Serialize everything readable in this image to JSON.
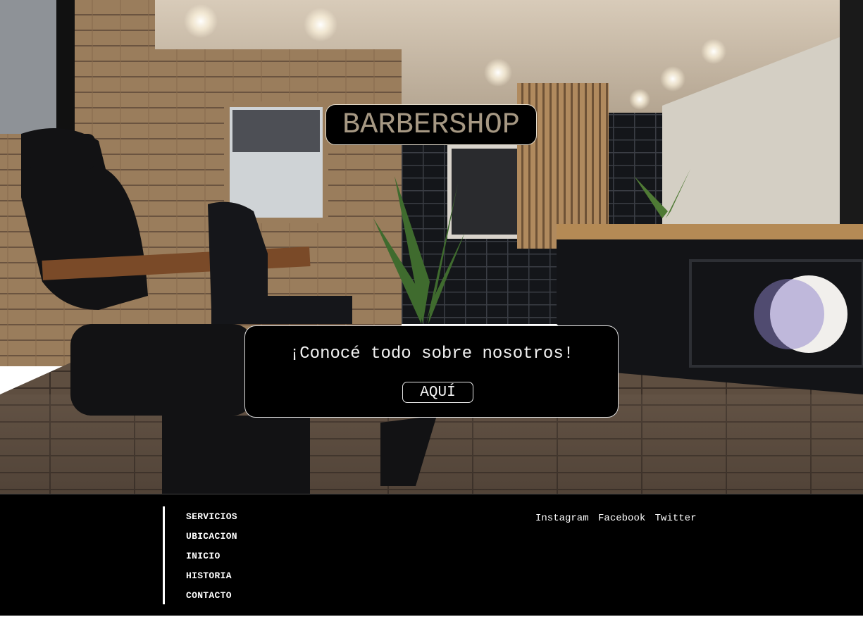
{
  "hero": {
    "brand_title": "BARBERSHOP",
    "cta_text": "¡Conocé todo sobre nosotros!",
    "cta_button": "AQUÍ",
    "background_image": "barbershop-interior-photo"
  },
  "footer": {
    "nav": [
      "SERVICIOS",
      "UBICACION",
      "INICIO",
      "HISTORIA",
      "CONTACTO"
    ],
    "social": [
      "Instagram",
      "Facebook",
      "Twitter"
    ]
  },
  "colors": {
    "brand_text": "#a69883",
    "panel_bg": "#000000",
    "text": "#ffffff"
  }
}
